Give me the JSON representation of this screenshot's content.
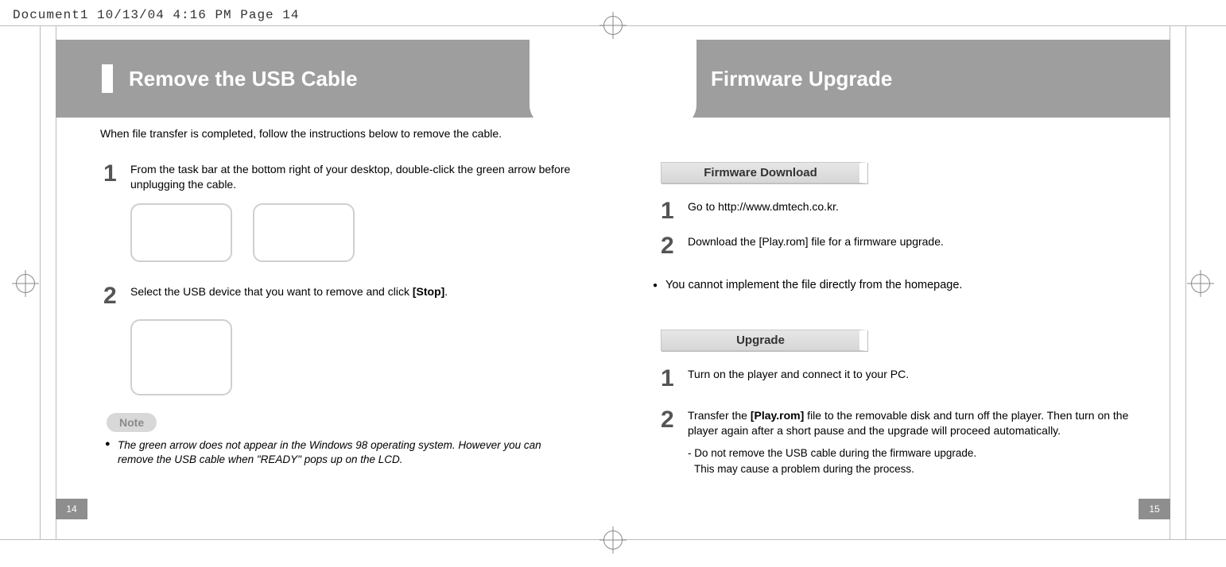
{
  "doc_header": "Document1  10/13/04  4:16 PM  Page 14",
  "left": {
    "title": "Remove the USB Cable",
    "intro": "When file transfer is completed, follow the instructions below to remove the cable.",
    "steps": [
      {
        "num": "1",
        "text_pre": "From the task bar at the bottom right of your desktop, double-click the green arrow before unplugging the cable."
      },
      {
        "num": "2",
        "text_pre": "Select the USB device that you want to remove and click ",
        "bold": "[Stop]",
        "text_post": "."
      }
    ],
    "note_label": "Note",
    "note_body": "The green arrow does not appear in the Windows 98 operating system. However you can remove the USB cable when \"READY\" pops up on the LCD.",
    "page_number": "14"
  },
  "right": {
    "title": "Firmware Upgrade",
    "section_a": {
      "label": "Firmware Download",
      "steps": [
        {
          "num": "1",
          "text": "Go to http://www.dmtech.co.kr."
        },
        {
          "num": "2",
          "text": "Download the [Play.rom] file for a firmware upgrade."
        }
      ],
      "bullet": "You cannot implement the file directly from the homepage."
    },
    "section_b": {
      "label": "Upgrade",
      "steps": [
        {
          "num": "1",
          "text": "Turn on the player and connect it to your PC."
        },
        {
          "num": "2",
          "text_pre": "Transfer the ",
          "bold": "[Play.rom]",
          "text_post": " file to the removable disk and turn off the player. Then turn on the player again after a short pause and the upgrade will proceed automatically.",
          "sub1": "- Do not remove the USB cable during the firmware upgrade.",
          "sub2": "  This may cause a problem during the process."
        }
      ]
    },
    "page_number": "15"
  }
}
